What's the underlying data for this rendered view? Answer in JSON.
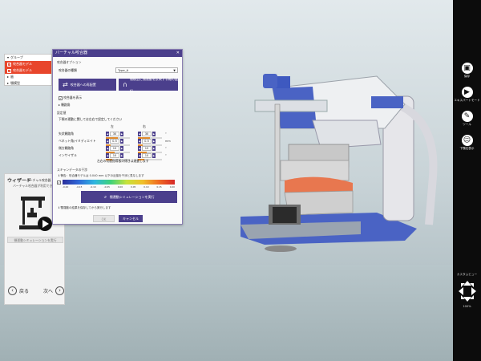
{
  "tree": {
    "items": [
      {
        "label": "グループ",
        "prefix": "▾"
      },
      {
        "label": "咬合器モデル",
        "checked": true,
        "selected": true
      },
      {
        "label": "咬合器モデル",
        "checked": true,
        "selected": true
      },
      {
        "label": "歯",
        "prefix": "▸"
      },
      {
        "label": "顎模型",
        "prefix": "▸"
      }
    ]
  },
  "wizard": {
    "title": "ウィザード",
    "subtitle": "バーチャル咬合器",
    "description": "バーチャル咬合器が利用できます",
    "action_button": "顎運動シミュレーションを実行",
    "back_label": "戻る",
    "next_label": "次へ"
  },
  "dialog": {
    "title": "バーチャル咬合器",
    "options_section": "咬合器オプション",
    "type_label": "咬合器の種類",
    "type_value": "Type_A",
    "transfer_button": "咬合器への再配置",
    "jaw_button": "顎模型に顎運動を反映する軸の選択",
    "show_articulator_label": "咬合器を表示",
    "condyle_label": "顆路角",
    "settings_section": "設定値",
    "settings_desc": "下顎の運動に関しては左右で設定してください",
    "left_header": "左",
    "right_header": "右",
    "params": [
      {
        "label": "矢状顆路角",
        "left": "30",
        "right": "30",
        "unit": "°",
        "left_fill": 0.5,
        "right_fill": 0.5
      },
      {
        "label": "ベネット角/イミディエイト",
        "left": "0.5",
        "right": "0.5",
        "unit": "mm",
        "left_fill": 0.2,
        "right_fill": 0.2
      },
      {
        "label": "側方顆路角",
        "left": "15",
        "right": "15",
        "unit": "°",
        "left_fill": 0.35,
        "right_fill": 0.35
      },
      {
        "label": "インサイザル",
        "left": "10",
        "right": "10",
        "unit": "°",
        "left_fill": 0.25,
        "right_fill": 0.25
      }
    ],
    "incisal_note": "左右の切歯指導板の傾きは連動します",
    "distance_section": "スキャンデータの干渉",
    "warning_text": "警告：咬合器モデルは 0.040 mm 以下の近接を干渉と見なします",
    "colorbar_ticks": [
      "-0.20",
      "-0.15",
      "-0.10",
      "-0.05",
      "0.00",
      "0.05",
      "0.10",
      "0.15",
      "0.20"
    ],
    "simulate_button": "顎運動シミュレーションを実行",
    "footnote": "顎運動の結果を保存してから実行します",
    "ok_label": "OK",
    "cancel_label": "キャンセル"
  },
  "toolbar": {
    "items": [
      {
        "label": "保存",
        "icon": "save-icon"
      },
      {
        "label": "エキスパートモード",
        "icon": "expert-mode-icon"
      },
      {
        "label": "ツール",
        "icon": "tools-icon"
      },
      {
        "label": "下顎位表示",
        "icon": "jaw-display-icon"
      }
    ],
    "camera_label": "カスタムビュー",
    "status": "100%"
  },
  "colors": {
    "accent": "#4b3f8c",
    "tree_selected": "#e8462c",
    "toolbar_bg": "#0c0c0c",
    "articulator_blue": "#4a63c4"
  }
}
